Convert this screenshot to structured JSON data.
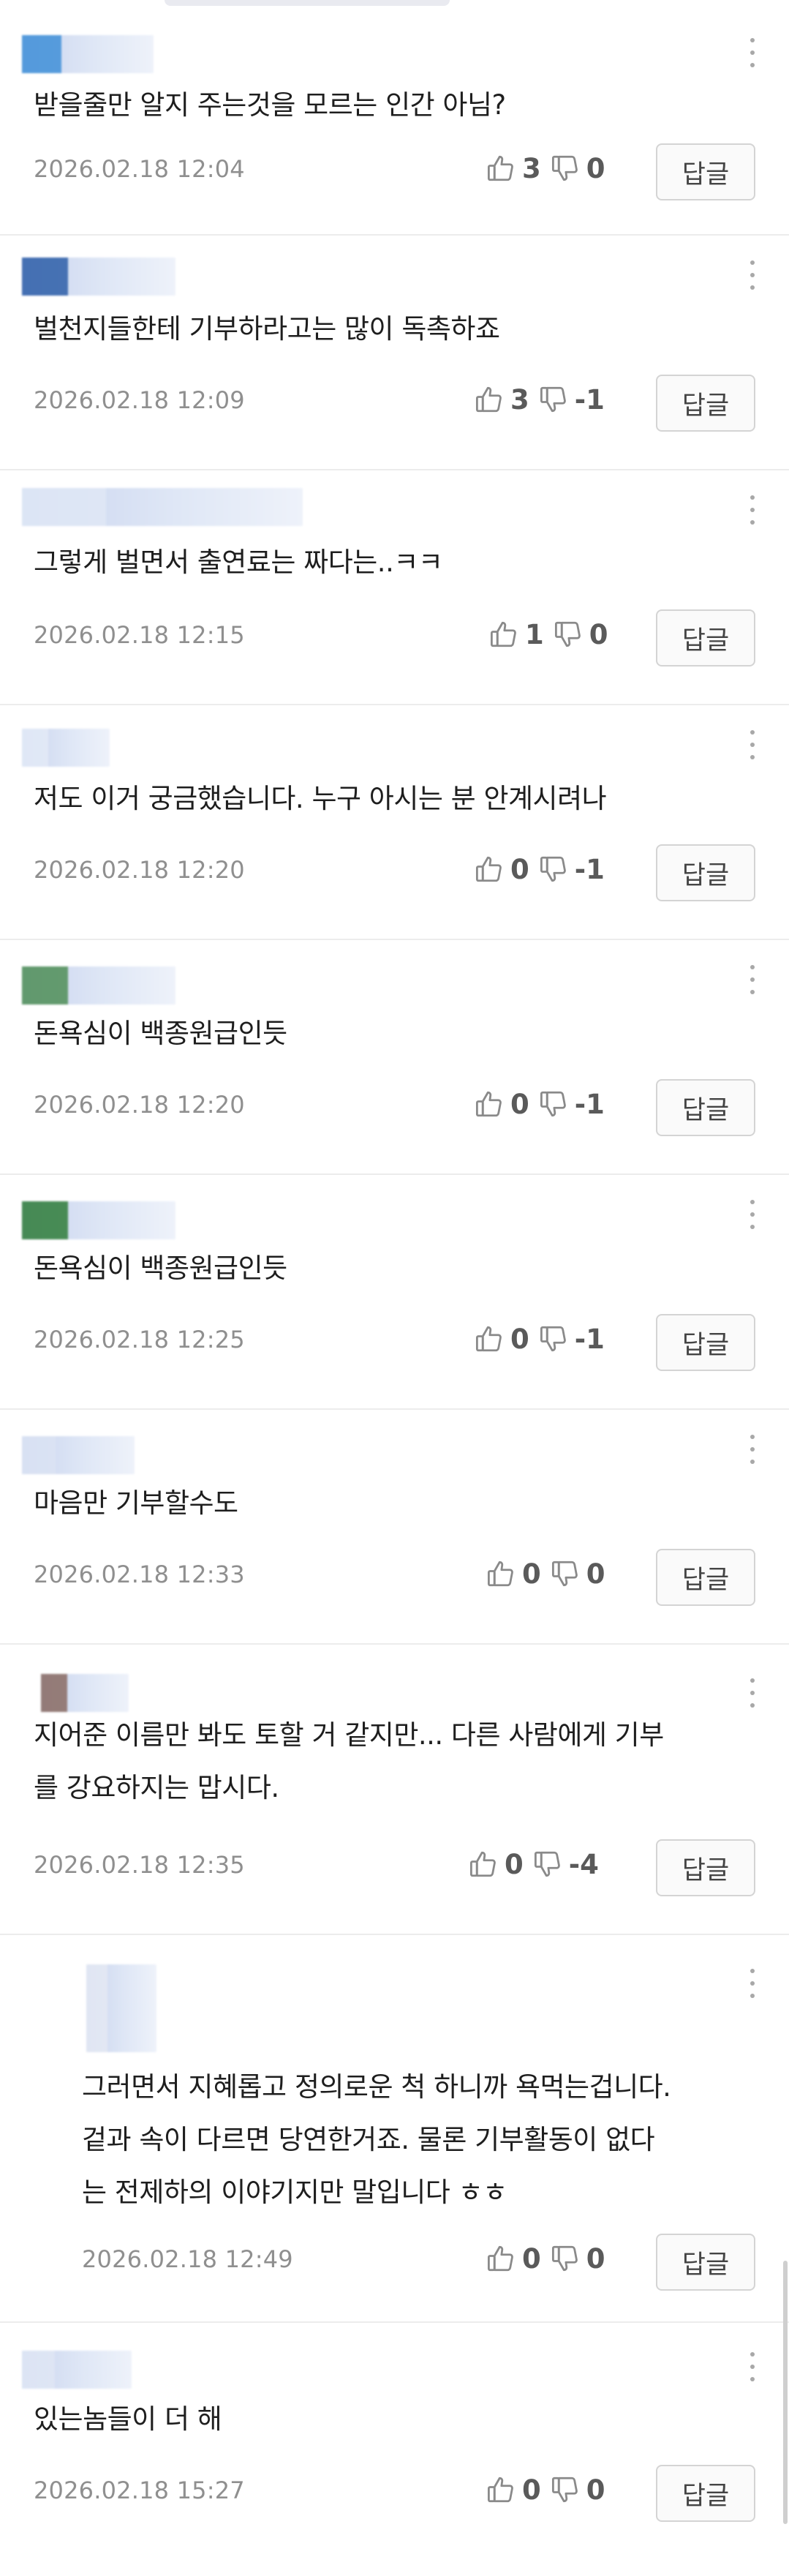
{
  "comments": [
    {
      "text": "받을줄만 알지  주는것을 모르는 인간 아님?",
      "date": "2026.02.18 12:04",
      "likes": "3",
      "dislikes": "0",
      "reply_label": "답글"
    },
    {
      "text": "벌천지들한테 기부하라고는 많이 독촉하죠",
      "date": "2026.02.18 12:09",
      "likes": "3",
      "dislikes": "-1",
      "reply_label": "답글"
    },
    {
      "text": "그렇게 벌면서 출연료는 짜다는..ㅋㅋ",
      "date": "2026.02.18 12:15",
      "likes": "1",
      "dislikes": "0",
      "reply_label": "답글"
    },
    {
      "text": "저도 이거 궁금했습니다. 누구 아시는 분 안계시려나",
      "date": "2026.02.18 12:20",
      "likes": "0",
      "dislikes": "-1",
      "reply_label": "답글"
    },
    {
      "text": "돈욕심이 백종원급인듯",
      "date": "2026.02.18 12:20",
      "likes": "0",
      "dislikes": "-1",
      "reply_label": "답글"
    },
    {
      "text": "돈욕심이 백종원급인듯",
      "date": "2026.02.18 12:25",
      "likes": "0",
      "dislikes": "-1",
      "reply_label": "답글"
    },
    {
      "text": "마음만 기부할수도",
      "date": "2026.02.18 12:33",
      "likes": "0",
      "dislikes": "0",
      "reply_label": "답글"
    },
    {
      "text_line1": "지어준 이름만 봐도 토할 거 같지만... 다른 사람에게 기부",
      "text_line2": "를 강요하지는 맙시다.",
      "date": "2026.02.18 12:35",
      "likes": "0",
      "dislikes": "-4",
      "reply_label": "답글"
    },
    {
      "text_line1": "그러면서 지혜롭고 정의로운 척 하니까 욕먹는겁니다.",
      "text_line2": "겉과 속이 다르면 당연한거죠. 물론 기부활동이 없다",
      "text_line3": "는 전제하의 이야기지만 말입니다 ㅎㅎ",
      "date": "2026.02.18 12:49",
      "likes": "0",
      "dislikes": "0",
      "reply_label": "답글"
    },
    {
      "text": "있는놈들이 더 해",
      "date": "2026.02.18 15:27",
      "likes": "0",
      "dislikes": "0",
      "reply_label": "답글"
    }
  ]
}
